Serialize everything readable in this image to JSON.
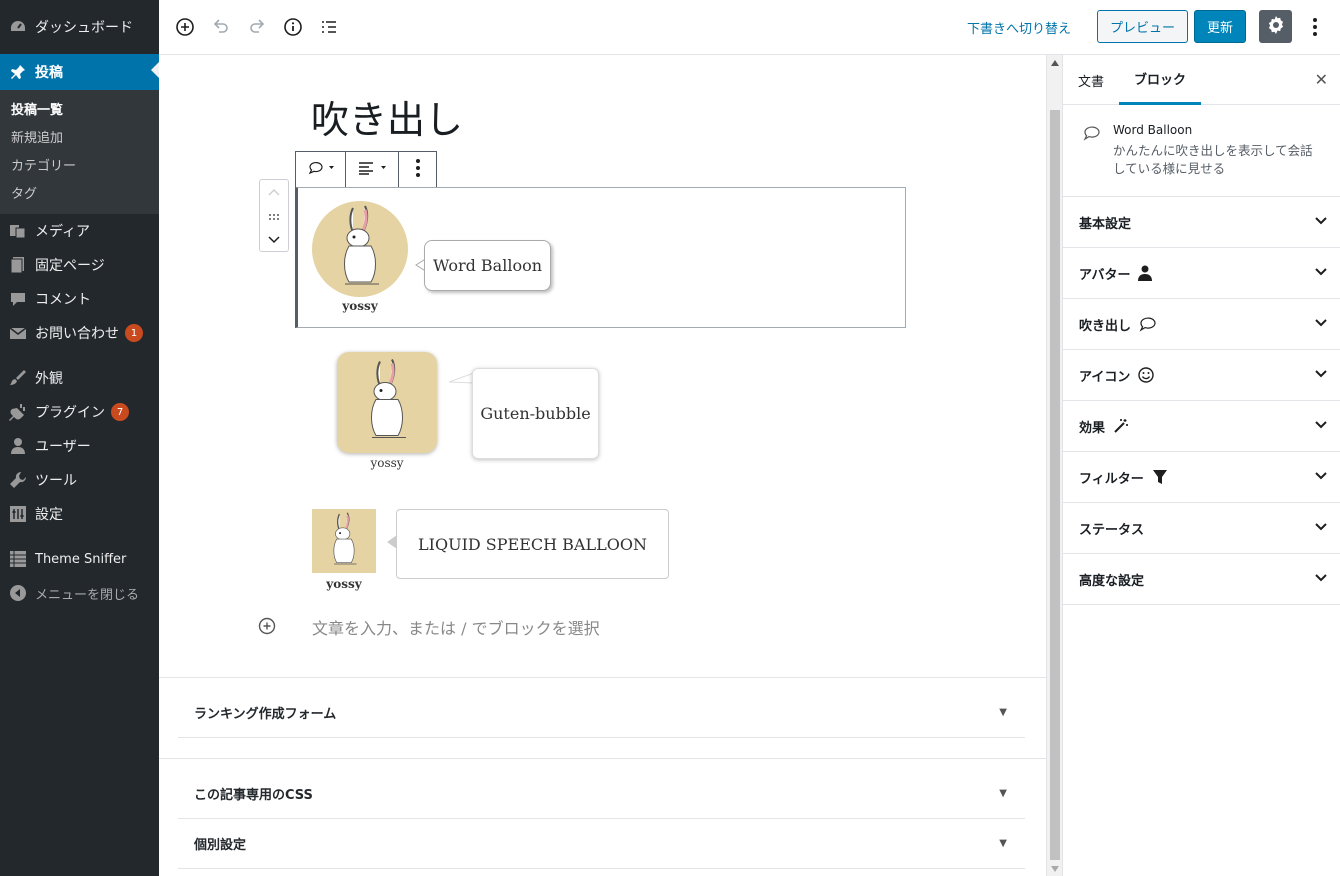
{
  "admin_menu": {
    "dashboard": "ダッシュボード",
    "posts": "投稿",
    "posts_sub": [
      "投稿一覧",
      "新規追加",
      "カテゴリー",
      "タグ"
    ],
    "media": "メディア",
    "pages": "固定ページ",
    "comments": "コメント",
    "contact": "お問い合わせ",
    "contact_badge": "1",
    "appearance": "外観",
    "plugins": "プラグイン",
    "plugins_badge": "7",
    "users": "ユーザー",
    "tools": "ツール",
    "settings": "設定",
    "theme_sniffer": "Theme Sniffer",
    "collapse": "メニューを閉じる"
  },
  "topbar": {
    "switch_to_draft": "下書きへ切り替え",
    "preview": "プレビュー",
    "update": "更新"
  },
  "editor": {
    "title": "吹き出し",
    "balloon1": {
      "text": "Word Balloon",
      "name": "yossy"
    },
    "balloon2": {
      "text": "Guten-bubble",
      "name": "yossy"
    },
    "balloon3": {
      "text": "LIQUID SPEECH BALLOON",
      "name": "yossy"
    },
    "placeholder": "文章を入力、または / でブロックを選択"
  },
  "metaboxes": [
    "ランキング作成フォーム",
    "この記事専用のCSS",
    "個別設定"
  ],
  "sidebar": {
    "tabs": [
      "文書",
      "ブロック"
    ],
    "active_tab": "ブロック",
    "block_name": "Word Balloon",
    "block_desc": "かんたんに吹き出しを表示して会話している様に見せる",
    "panels": [
      "基本設定",
      "アバター",
      "吹き出し",
      "アイコン",
      "効果",
      "フィルター",
      "ステータス",
      "高度な設定"
    ]
  },
  "colors": {
    "accent": "#0073aa",
    "admin_bg": "#23282d",
    "badge": "#ca4a1f",
    "avatar_bg": "#e6d3a3"
  }
}
